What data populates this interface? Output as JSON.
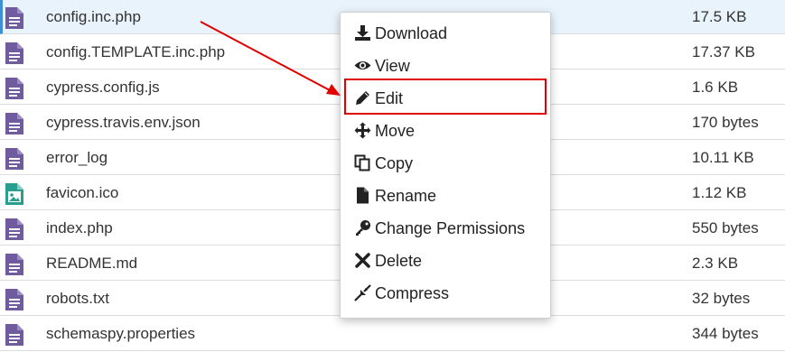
{
  "files": [
    {
      "name": "config.inc.php",
      "size": "17.5 KB",
      "icon": "file-text-icon",
      "selected": true
    },
    {
      "name": "config.TEMPLATE.inc.php",
      "size": "17.37 KB",
      "icon": "file-text-icon"
    },
    {
      "name": "cypress.config.js",
      "size": "1.6 KB",
      "icon": "file-text-icon"
    },
    {
      "name": "cypress.travis.env.json",
      "size": "170 bytes",
      "icon": "file-text-icon"
    },
    {
      "name": "error_log",
      "size": "10.11 KB",
      "icon": "file-text-icon"
    },
    {
      "name": "favicon.ico",
      "size": "1.12 KB",
      "icon": "file-image-icon"
    },
    {
      "name": "index.php",
      "size": "550 bytes",
      "icon": "file-text-icon"
    },
    {
      "name": "README.md",
      "size": "2.3 KB",
      "icon": "file-text-icon"
    },
    {
      "name": "robots.txt",
      "size": "32 bytes",
      "icon": "file-text-icon"
    },
    {
      "name": "schemaspy.properties",
      "size": "344 bytes",
      "icon": "file-text-icon"
    }
  ],
  "context_menu": {
    "items": [
      {
        "label": "Download",
        "icon": "download-icon"
      },
      {
        "label": "View",
        "icon": "eye-icon"
      },
      {
        "label": "Edit",
        "icon": "pencil-icon",
        "highlighted": true
      },
      {
        "label": "Move",
        "icon": "move-arrows-icon"
      },
      {
        "label": "Copy",
        "icon": "copy-icon"
      },
      {
        "label": "Rename",
        "icon": "file-icon"
      },
      {
        "label": "Change Permissions",
        "icon": "key-icon"
      },
      {
        "label": "Delete",
        "icon": "x-icon"
      },
      {
        "label": "Compress",
        "icon": "compress-icon"
      }
    ]
  },
  "colors": {
    "file_icon": "#6f5b9e",
    "image_icon": "#2a9d8f",
    "highlight_border": "#e00000",
    "arrow": "#e00000",
    "selected_row": "#e9f3fb"
  }
}
